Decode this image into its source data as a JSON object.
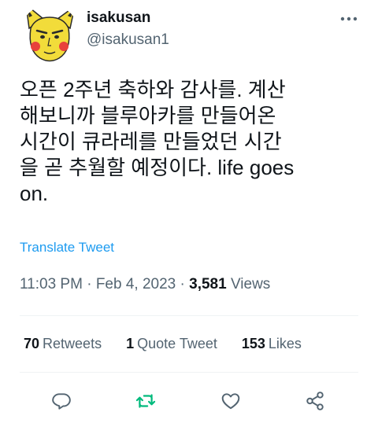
{
  "user": {
    "name": "isakusan",
    "handle": "@isakusan1"
  },
  "tweet": {
    "text": "오픈 2주년 축하와 감사를. 계산\n해보니까 블루아카를 만들어온\n시간이 큐라레를 만들었던 시간\n을 곧 추월할 예정이다. life goes\non.",
    "translate_label": "Translate Tweet"
  },
  "meta": {
    "time": "11:03 PM",
    "separator": "·",
    "date": "Feb 4, 2023",
    "views_count": "3,581",
    "views_label": "Views"
  },
  "stats": {
    "retweets_count": "70",
    "retweets_label": "Retweets",
    "quotes_count": "1",
    "quotes_label": "Quote Tweet",
    "likes_count": "153",
    "likes_label": "Likes"
  },
  "icons": {
    "more": "more-horizontal-icon",
    "reply": "reply-icon",
    "retweet": "retweet-icon",
    "like": "heart-icon",
    "share": "share-icon"
  },
  "colors": {
    "text": "#0f1419",
    "muted": "#536471",
    "link": "#1d9bf0",
    "retweet_accent": "#00ba7c",
    "divider": "#eff3f4"
  }
}
